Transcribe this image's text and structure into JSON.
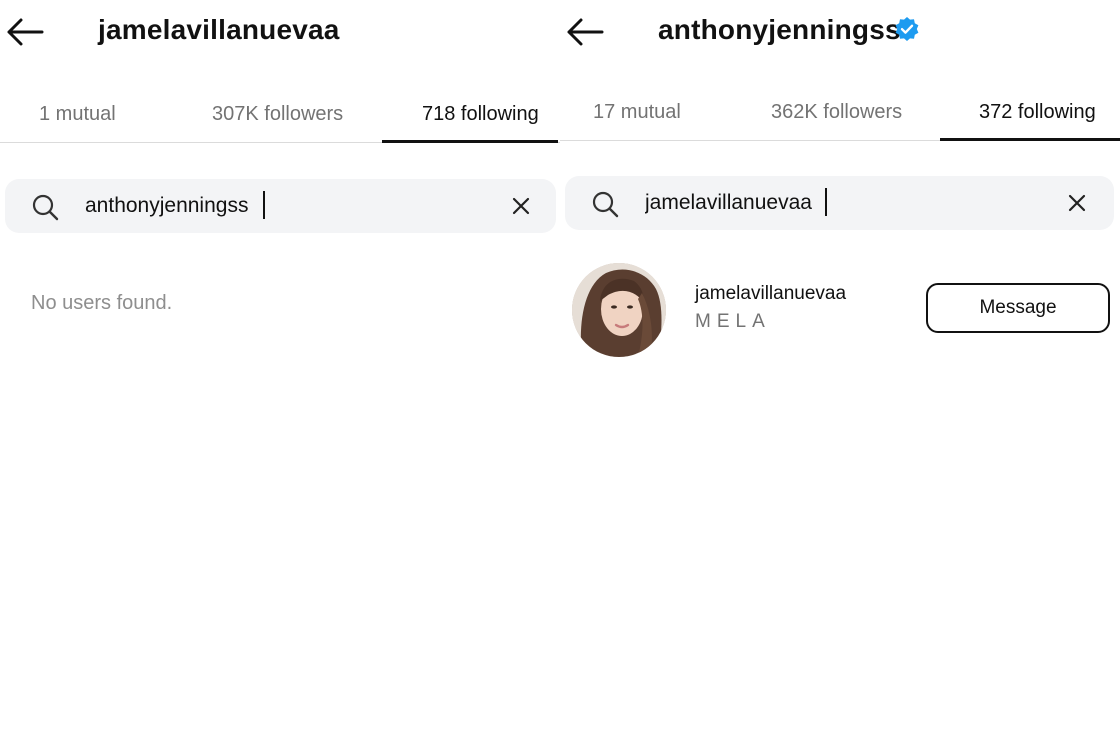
{
  "left_panel": {
    "header": {
      "username": "jamelavillanuevaa",
      "back_icon": "arrow-left-icon"
    },
    "tabs": [
      {
        "label": "1 mutual",
        "active": false
      },
      {
        "label": "307K followers",
        "active": false
      },
      {
        "label": "718 following",
        "active": true
      }
    ],
    "search": {
      "value": "anthonyjenningss",
      "search_icon": "magnifier-icon",
      "clear_icon": "close-icon"
    },
    "empty_message": "No users found."
  },
  "right_panel": {
    "header": {
      "username": "anthonyjenningss",
      "verified": true,
      "back_icon": "arrow-left-icon",
      "badge_icon": "verified-badge-icon",
      "badge_color": "#1d9bf0"
    },
    "tabs": [
      {
        "label": "17 mutual",
        "active": false
      },
      {
        "label": "362K followers",
        "active": false
      },
      {
        "label": "372 following",
        "active": true
      }
    ],
    "search": {
      "value": "jamelavillanuevaa",
      "search_icon": "magnifier-icon",
      "clear_icon": "close-icon"
    },
    "results": [
      {
        "username": "jamelavillanuevaa",
        "full_name": "MELA",
        "action_label": "Message"
      }
    ]
  },
  "colors": {
    "text_primary": "#111111",
    "text_secondary": "#737373",
    "divider": "#dbdbdb",
    "search_bg": "#f3f4f6",
    "verified": "#1d9bf0"
  }
}
